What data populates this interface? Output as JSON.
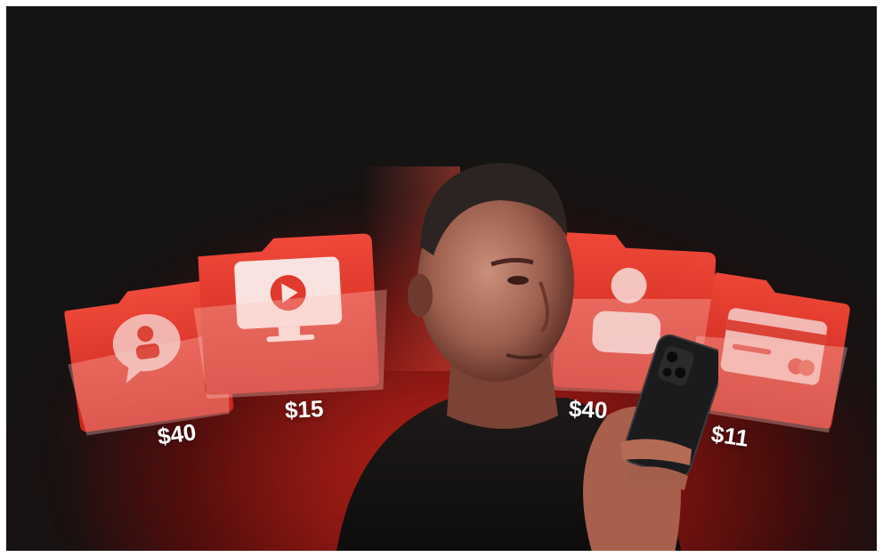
{
  "scene": {
    "description_icons": [
      "chat-user-icon",
      "video-play-icon",
      "user-profile-icon",
      "credit-card-icon"
    ],
    "accent_color": "#e8342a",
    "background_color": "#141414"
  },
  "prices": {
    "chat": "$40",
    "video": "$15",
    "profile": "$40",
    "card": "$11"
  }
}
